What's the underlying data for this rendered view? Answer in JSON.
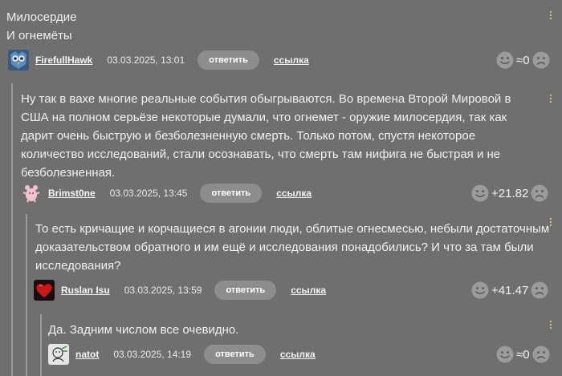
{
  "comments": [
    {
      "text": "Милосердие\nИ огнемёты",
      "author": "FirefullHawk",
      "date": "03.03.2025, 13:01",
      "reply_label": "ответить",
      "link_label": "ссылка",
      "score": "≈0",
      "avatar_icon": "owl-avatar-icon"
    },
    {
      "text": "Ну так в вахе многие реальные события обыгрываются. Во времена Второй Мировой в США на полном серьёзе некоторые думали, что огнемет - оружие милосердия, так как дарит очень быструю и безболезненную смерть. Только потом, спустя некоторое количество исследований, стали осознавать, что смерть там нифига не быстрая и не безболезненная.",
      "author": "Brimst0ne",
      "date": "03.03.2025, 13:45",
      "reply_label": "ответить",
      "link_label": "ссылка",
      "score": "+21.82",
      "avatar_icon": "pink-creature-avatar-icon"
    },
    {
      "text": "То есть кричащие и корчащиеся в агонии люди, облитые огнесмесью, небыли достаточным доказательством обратного и им ещё и исследования понадобились? И что за там были исследования?",
      "author": "Ruslan Isu",
      "date": "03.03.2025, 13:59",
      "reply_label": "ответить",
      "link_label": "ссылка",
      "score": "+41.47",
      "avatar_icon": "red-heart-avatar-icon"
    },
    {
      "text": "Да. Задним числом все очевидно.",
      "author": "natot",
      "date": "03.03.2025, 14:19",
      "reply_label": "ответить",
      "link_label": "ссылка",
      "score": "≈0",
      "avatar_icon": "sketch-avatar-icon"
    }
  ],
  "colors": {
    "background": "#6f6f6f",
    "thread_line": "#9a9a9a",
    "button_bg": "#8d8d8d",
    "menu_dots": "#d8c070"
  }
}
